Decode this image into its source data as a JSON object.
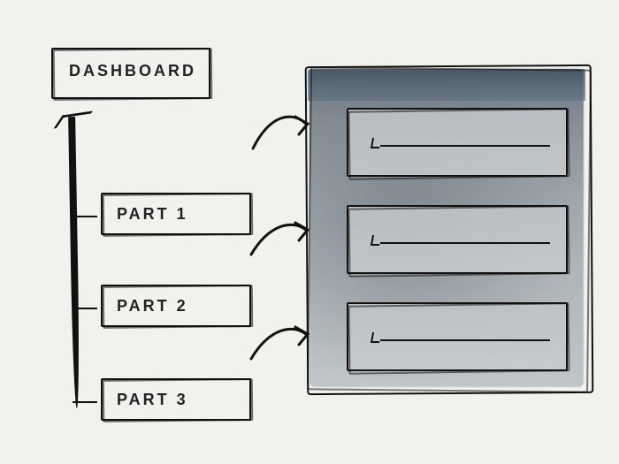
{
  "title_box": {
    "label": "DASHBOARD"
  },
  "parts": [
    {
      "label": "PART 1"
    },
    {
      "label": "PART 2"
    },
    {
      "label": "PART 3"
    }
  ],
  "panel": {
    "cards": [
      {
        "id": "card-1"
      },
      {
        "id": "card-2"
      },
      {
        "id": "card-3"
      }
    ]
  }
}
